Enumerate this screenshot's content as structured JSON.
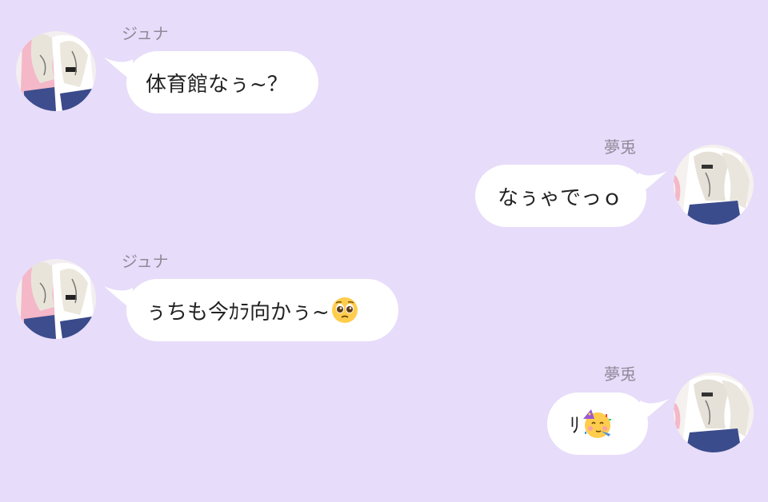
{
  "chat": {
    "messages": [
      {
        "sender": "ジュナ",
        "side": "left",
        "text": "体育館なぅ~？",
        "emoji": ""
      },
      {
        "sender": "夢兎",
        "side": "right",
        "text": "なぅゃでっｏ",
        "emoji": ""
      },
      {
        "sender": "ジュナ",
        "side": "left",
        "text": "ぅちも今ｶﾗ向かぅ~",
        "emoji": "pleading-face-emoji"
      },
      {
        "sender": "夢兎",
        "side": "right",
        "text": "ﾘ",
        "emoji": "partying-face-emoji"
      }
    ]
  },
  "colors": {
    "background": "#e7dcfa",
    "bubble": "#ffffff",
    "sender_name": "#8f8a98",
    "text": "#222222"
  }
}
